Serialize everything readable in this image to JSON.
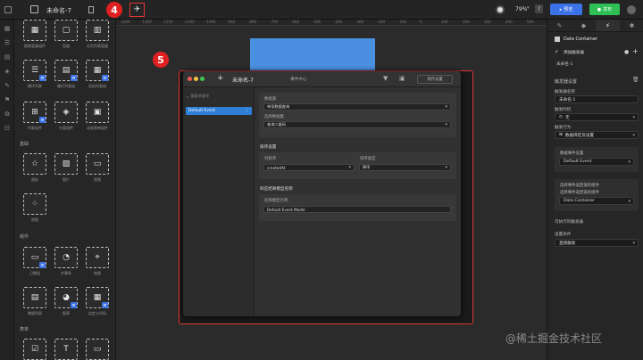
{
  "topbar": {
    "doc_title": "未命名-7",
    "zoom": "79%",
    "preview": "预览",
    "publish": "发布"
  },
  "callouts": {
    "c4": "4",
    "c5": "5"
  },
  "palette": {
    "row1": [
      "图表容器组件",
      "容器",
      "分页列表容器"
    ],
    "row2": [
      "循环列表",
      "循环列表组",
      "培训列表组"
    ],
    "row3": [
      "列表组件",
      "分类组件",
      "动态表单组件"
    ],
    "sec_basic": "基础",
    "basic": [
      "图标",
      "图片",
      "视频",
      "地图"
    ],
    "sec_display": "组件",
    "display": [
      "日期组",
      "步骤条",
      "地图",
      "数据列表",
      "图表",
      "自定义代码"
    ],
    "sec_form": "表单"
  },
  "ruler": [
    "-1400",
    "-1300",
    "-1200",
    "-1100",
    "-1000",
    "-900",
    "-800",
    "-700",
    "-600",
    "-500",
    "-400",
    "-300",
    "-200",
    "-100",
    "0",
    "100",
    "200",
    "300",
    "400",
    "500"
  ],
  "dialog": {
    "title": "未命名-7",
    "center_label": "事件中心",
    "publish_btn": "保存设置",
    "search_placeholder": "搜索关键字",
    "event_item": "Default Event",
    "section_source": "数据源",
    "source_select": "单条数据查询",
    "section_query": "选择数据集",
    "query_select": "查询二维码",
    "section_sort": "排序设置",
    "sort_field_label": "列排序",
    "sort_field": "createdAt",
    "sort_type_label": "排序类型",
    "sort_type": "降序",
    "section_model": "响应结果模型名称",
    "model_label": "结果模型名称",
    "model_value": "Default Event Model"
  },
  "right": {
    "tabs": [
      "style-icon",
      "settings-icon",
      "event-icon",
      "debug-icon"
    ],
    "container": "Data Container",
    "add_trigger": "添加触发器",
    "trigger_name": "未命名-1",
    "trigger_settings": "触发器设置",
    "trigger_name_label": "触发器名称",
    "trigger_name_value": "未命名-1",
    "trigger_time_label": "触发时机",
    "trigger_time_value": "无",
    "trigger_action_label": "触发行为",
    "trigger_action_value": "数据绑定及设置",
    "sub_event_label": "数据事件设置",
    "sub_event_value": "Default Event",
    "sub_target_label": "选择事件返回值的组件",
    "sub_target_sub": "选择事件返回值的组件",
    "sub_target_value": "Data Container",
    "more_label": "可执行的触发器",
    "exec_label": "设置条件",
    "exec_value": "直接触发"
  },
  "watermark": "@稀土掘金技术社区",
  "colors": {
    "accent": "#3b72e8",
    "publish": "#2fbf55",
    "callout": "#e02020"
  }
}
